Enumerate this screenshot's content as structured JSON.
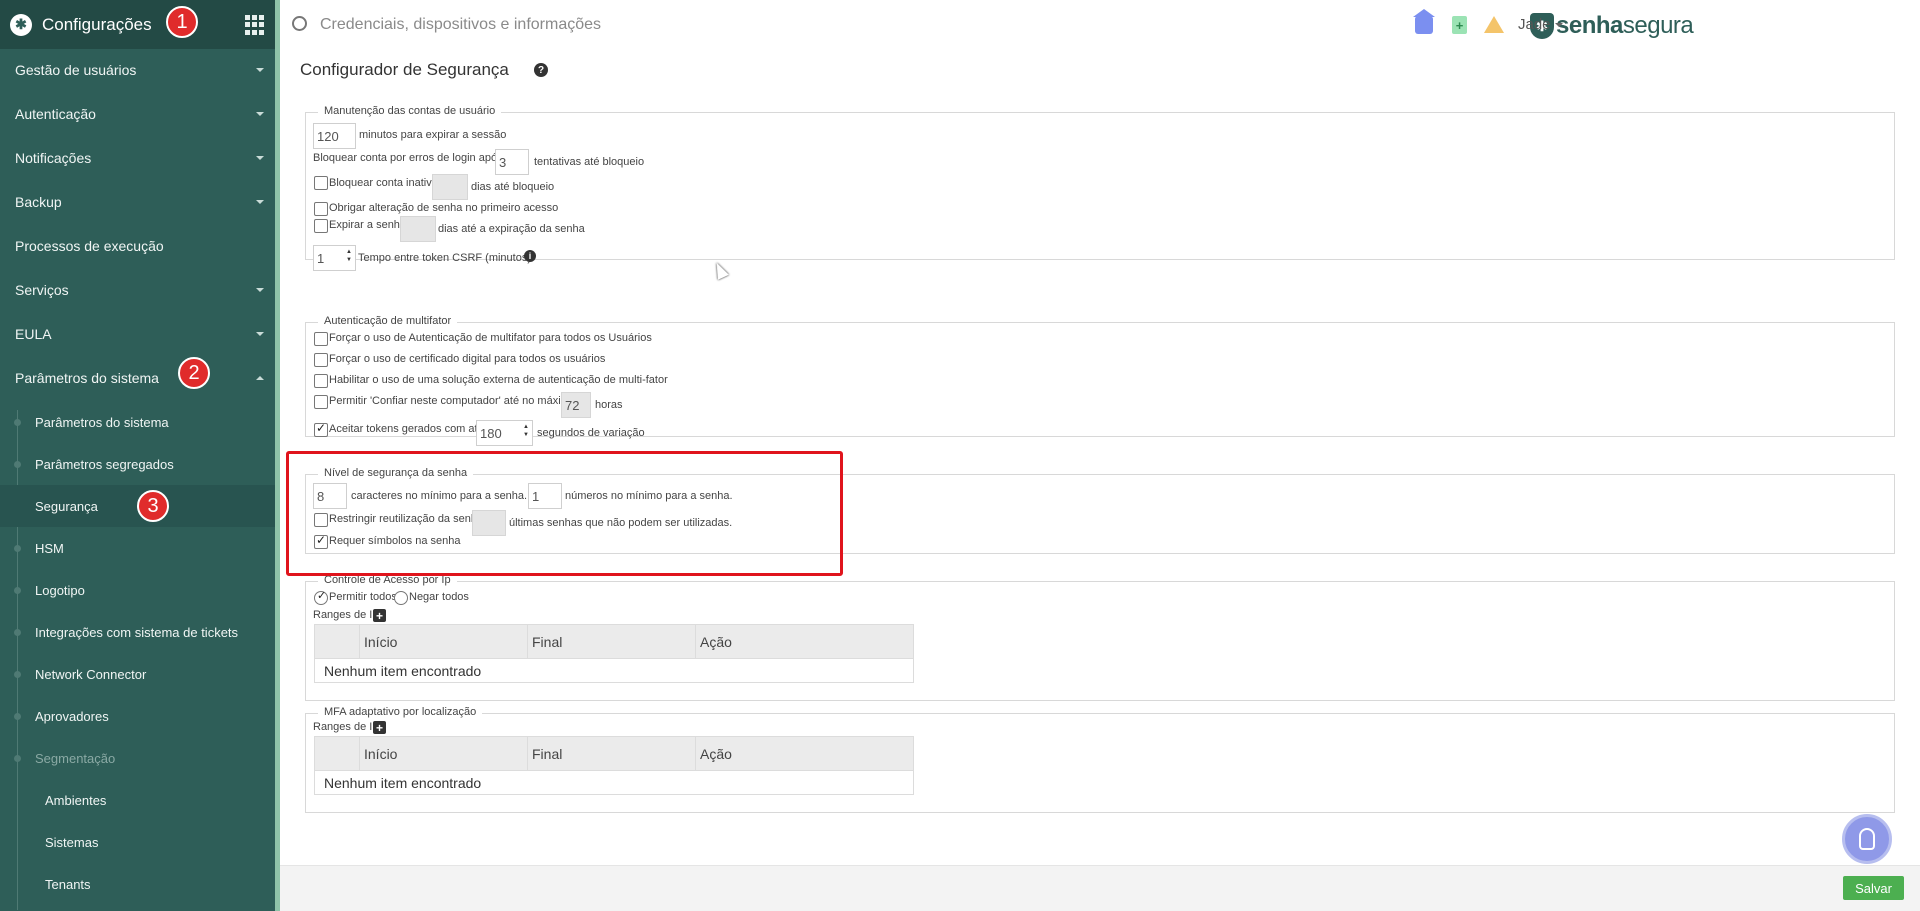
{
  "sidebar": {
    "title": "Configurações",
    "items": [
      {
        "label": "Gestão de usuários"
      },
      {
        "label": "Autenticação"
      },
      {
        "label": "Notificações"
      },
      {
        "label": "Backup"
      },
      {
        "label": "Processos de execução"
      },
      {
        "label": "Serviços"
      },
      {
        "label": "EULA"
      },
      {
        "label": "Parâmetros do sistema"
      }
    ],
    "subitems": [
      {
        "label": "Parâmetros do sistema"
      },
      {
        "label": "Parâmetros segregados"
      },
      {
        "label": "Segurança"
      },
      {
        "label": "HSM"
      },
      {
        "label": "Logotipo"
      },
      {
        "label": "Integrações com sistema de tickets"
      },
      {
        "label": "Network Connector"
      },
      {
        "label": "Aprovadores"
      },
      {
        "label": "Segmentação"
      }
    ],
    "subsubitems": [
      {
        "label": "Ambientes"
      },
      {
        "label": "Sistemas"
      },
      {
        "label": "Tenants"
      }
    ]
  },
  "badges": [
    "1",
    "2",
    "3"
  ],
  "topbar": {
    "search_placeholder": "Credenciais, dispositivos e informações",
    "brand_bold": "senha",
    "brand_light": "segura",
    "user": "Jade"
  },
  "page": {
    "title": "Configurador de Segurança"
  },
  "maintenance": {
    "legend": "Manutenção das contas de usuário",
    "session_value": "120",
    "session_label": "minutos para expirar a sessão",
    "block_login_label": "Bloquear conta por erros de login após",
    "block_login_value": "3",
    "attempts_label": "tentativas até bloqueio",
    "inactive_label": "Bloquear conta inativa",
    "inactive_days_label": "dias até bloqueio",
    "force_change_label": "Obrigar alteração de senha no primeiro acesso",
    "expire_label": "Expirar a senha",
    "expire_days_label": "dias até a expiração da senha",
    "csrf_value": "1",
    "csrf_label": "Tempo entre token CSRF (minutos)*"
  },
  "mfa": {
    "legend": "Autenticação de multifator",
    "force_mfa_label": "Forçar o uso de Autenticação de multifator para todos os Usuários",
    "force_cert_label": "Forçar o uso de certificado digital para todos os usuários",
    "external_label": "Habilitar o uso de uma solução externa de autenticação de multi-fator",
    "trust_label": "Permitir 'Confiar neste computador' até no máximo",
    "trust_value": "72",
    "trust_unit": "horas",
    "accept_tokens_label": "Aceitar tokens gerados com até",
    "accept_tokens_value": "180",
    "accept_tokens_unit": "segundos de variação"
  },
  "password_level": {
    "legend": "Nível de segurança da senha",
    "min_chars_value": "8",
    "min_chars_label": "caracteres no mínimo para a senha.",
    "min_numbers_value": "1",
    "min_numbers_label": "números no mínimo para a senha.",
    "restrict_label": "Restringir reutilização da senha",
    "restrict_unit": "últimas senhas que não podem ser utilizadas.",
    "symbols_label": "Requer símbolos na senha"
  },
  "ip_access": {
    "legend": "Controle de Acesso por Ip",
    "allow_all": "Permitir todos",
    "deny_all": "Negar todos",
    "ranges_label": "Ranges de IP",
    "columns": [
      "",
      "Início",
      "Final",
      "Ação"
    ],
    "empty": "Nenhum item encontrado"
  },
  "mfa_location": {
    "legend": "MFA adaptativo por localização",
    "ranges_label": "Ranges de IP",
    "columns": [
      "",
      "Início",
      "Final",
      "Ação"
    ],
    "empty": "Nenhum item encontrado"
  },
  "footer": {
    "save_label": "Salvar"
  },
  "colors": {
    "sidebar": "#2e5e58",
    "accent": "#4caf50",
    "highlight": "#e0141c"
  }
}
